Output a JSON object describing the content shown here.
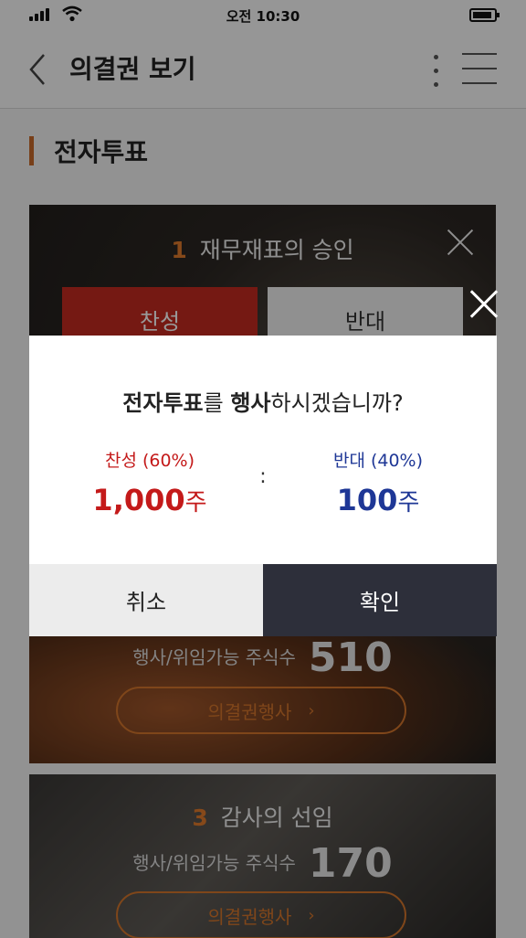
{
  "statusbar": {
    "time": "오전 10:30"
  },
  "header": {
    "title": "의결권 보기"
  },
  "section": {
    "title": "전자투표"
  },
  "cards": [
    {
      "number": "1",
      "title": "재무재표의 승인",
      "agree_label": "찬성",
      "oppose_label": "반대",
      "shares_label": "행사/위임가능 주식수",
      "shares_value": "510",
      "exercise_label": "의결권행사",
      "chevron": "›"
    },
    {
      "number": "3",
      "title": "감사의 선임",
      "shares_label": "행사/위임가능 주식수",
      "shares_value": "170",
      "exercise_label": "의결권행사",
      "chevron": "›"
    }
  ],
  "modal": {
    "question_bold1": "전자투표",
    "question_mid": "를 ",
    "question_bold2": "행사",
    "question_end": "하시겠습니까?",
    "agree_label": "찬성 (60%)",
    "agree_amount": "1,000",
    "oppose_label": "반대 (40%)",
    "oppose_amount": "100",
    "unit": "주",
    "separator": ":",
    "cancel_label": "취소",
    "confirm_label": "확인"
  },
  "colors": {
    "accent": "#c8692a",
    "agree_red": "#c41a1a",
    "oppose_blue": "#1e3796",
    "confirm_dark": "#2d2f3a"
  }
}
